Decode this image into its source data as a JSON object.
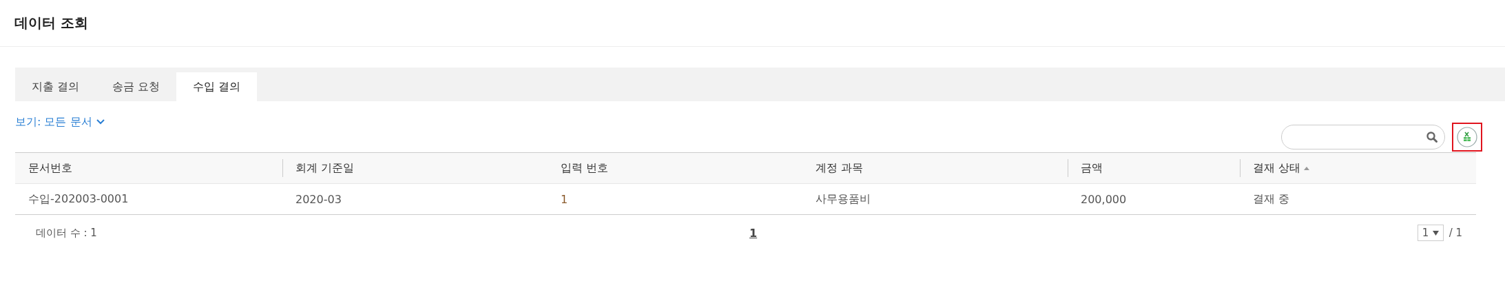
{
  "page_title": "데이터 조회",
  "tabs": [
    {
      "label": "지출 결의",
      "selected": false
    },
    {
      "label": "송금 요청",
      "selected": false
    },
    {
      "label": "수입 결의",
      "selected": true
    }
  ],
  "view_filter": "보기: 모든 문서",
  "table": {
    "columns": [
      {
        "label": "문서번호",
        "sorted": false
      },
      {
        "label": "회계 기준일",
        "sorted": false
      },
      {
        "label": "입력 번호",
        "sorted": false
      },
      {
        "label": "계정 과목",
        "sorted": false
      },
      {
        "label": "금액",
        "sorted": false
      },
      {
        "label": "결재 상태",
        "sorted": true
      }
    ],
    "rows": [
      [
        "수입-202003-0001",
        "2020-03",
        "1",
        "사무용품비",
        "200,000",
        "결재 중"
      ]
    ]
  },
  "data_count": "데이터 수 : 1",
  "pagination": {
    "pages": [
      {
        "label": "1",
        "selected": true
      }
    ],
    "page_select": "1",
    "total": "/ 1"
  }
}
